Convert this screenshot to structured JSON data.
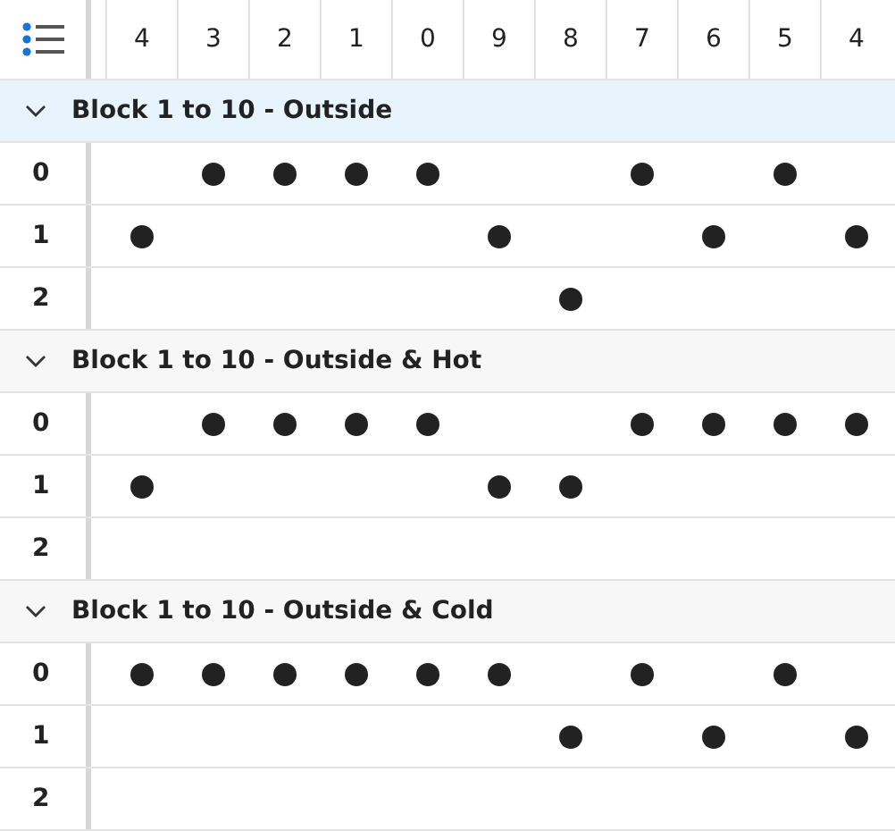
{
  "columns": [
    "4",
    "3",
    "2",
    "1",
    "0",
    "9",
    "8",
    "7",
    "6",
    "5",
    "4"
  ],
  "groups": [
    {
      "title": "Block 1 to 10 - Outside",
      "selected": true,
      "expanded": true,
      "rows": [
        {
          "label": "0",
          "cells": [
            false,
            true,
            true,
            true,
            true,
            false,
            false,
            true,
            false,
            true,
            false
          ]
        },
        {
          "label": "1",
          "cells": [
            true,
            false,
            false,
            false,
            false,
            true,
            false,
            false,
            true,
            false,
            true
          ]
        },
        {
          "label": "2",
          "cells": [
            false,
            false,
            false,
            false,
            false,
            false,
            true,
            false,
            false,
            false,
            false
          ]
        }
      ]
    },
    {
      "title": "Block 1 to 10 - Outside & Hot",
      "selected": false,
      "expanded": true,
      "rows": [
        {
          "label": "0",
          "cells": [
            false,
            true,
            true,
            true,
            true,
            false,
            false,
            true,
            true,
            true,
            true
          ]
        },
        {
          "label": "1",
          "cells": [
            true,
            false,
            false,
            false,
            false,
            true,
            true,
            false,
            false,
            false,
            false
          ]
        },
        {
          "label": "2",
          "cells": [
            false,
            false,
            false,
            false,
            false,
            false,
            false,
            false,
            false,
            false,
            false
          ]
        }
      ]
    },
    {
      "title": "Block 1 to 10 - Outside & Cold",
      "selected": false,
      "expanded": true,
      "rows": [
        {
          "label": "0",
          "cells": [
            true,
            true,
            true,
            true,
            true,
            true,
            false,
            true,
            false,
            true,
            false
          ]
        },
        {
          "label": "1",
          "cells": [
            false,
            false,
            false,
            false,
            false,
            false,
            true,
            false,
            true,
            false,
            true
          ]
        },
        {
          "label": "2",
          "cells": [
            false,
            false,
            false,
            false,
            false,
            false,
            false,
            false,
            false,
            false,
            false
          ]
        }
      ]
    }
  ]
}
